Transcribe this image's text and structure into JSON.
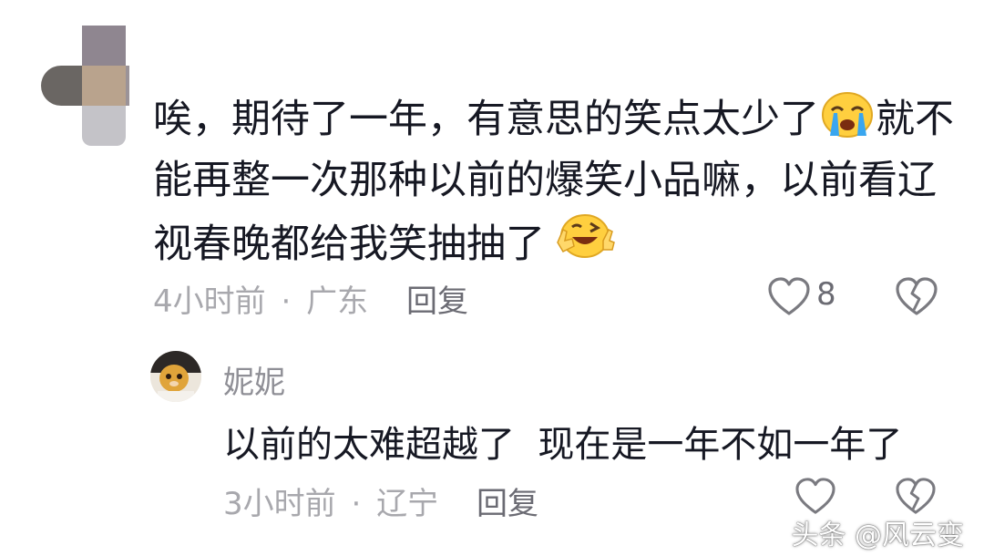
{
  "comment": {
    "text_part1": "唉，期待了一年，有意思的笑点太少了",
    "emoji1": "crying-face",
    "text_part2": "就不能再整一次那种以前的爆笑小品嘛，以前看辽视春晚都给我笑抽抽了",
    "emoji2": "laughing-wink-face",
    "time": "4小时前",
    "separator": "·",
    "location": "广东",
    "reply_label": "回复",
    "like_count": "8"
  },
  "reply": {
    "username": "妮妮",
    "text": "以前的太难超越了  现在是一年不如一年了",
    "time": "3小时前",
    "separator": "·",
    "location": "辽宁",
    "reply_label": "回复"
  },
  "watermark": "头条 @风云变",
  "colors": {
    "text": "#161823",
    "meta": "#a8a8ad",
    "icon": "#7a7a80"
  }
}
